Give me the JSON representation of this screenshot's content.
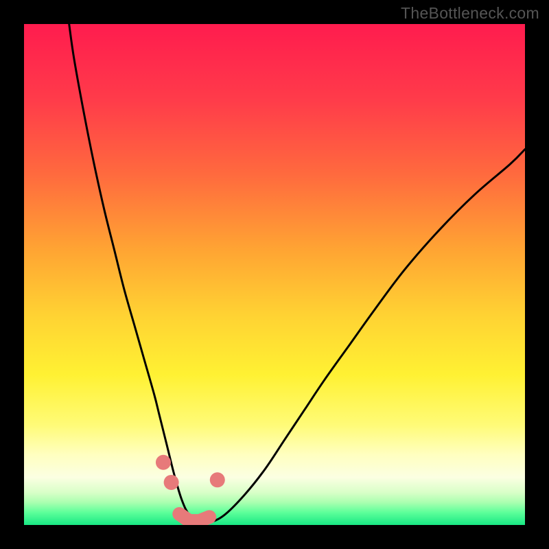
{
  "watermark": "TheBottleneck.com",
  "chart_data": {
    "type": "line",
    "title": "",
    "xlabel": "",
    "ylabel": "",
    "xlim": [
      0,
      100
    ],
    "ylim": [
      0,
      100
    ],
    "grid": false,
    "legend": false,
    "gradient_stops": [
      {
        "offset": 0.0,
        "color": "#ff1c4e"
      },
      {
        "offset": 0.15,
        "color": "#ff3b4a"
      },
      {
        "offset": 0.3,
        "color": "#ff6a3e"
      },
      {
        "offset": 0.45,
        "color": "#ffa433"
      },
      {
        "offset": 0.58,
        "color": "#ffd233"
      },
      {
        "offset": 0.7,
        "color": "#fff133"
      },
      {
        "offset": 0.8,
        "color": "#fffb77"
      },
      {
        "offset": 0.86,
        "color": "#ffffc0"
      },
      {
        "offset": 0.905,
        "color": "#fbffe2"
      },
      {
        "offset": 0.935,
        "color": "#d9ffc8"
      },
      {
        "offset": 0.955,
        "color": "#aaffb0"
      },
      {
        "offset": 0.975,
        "color": "#5dff9a"
      },
      {
        "offset": 1.0,
        "color": "#18e884"
      }
    ],
    "series": [
      {
        "name": "bottleneck-curve",
        "color": "#000000",
        "x": [
          9,
          10,
          12,
          14,
          16,
          18,
          20,
          22,
          24,
          26,
          27,
          28.5,
          30,
          31.5,
          33,
          35,
          37,
          40,
          44,
          48,
          52,
          56,
          60,
          65,
          70,
          76,
          83,
          90,
          97,
          100
        ],
        "y": [
          100,
          93,
          82,
          72,
          63,
          55,
          47,
          40,
          33,
          26,
          22,
          16,
          10,
          5,
          2,
          0.5,
          0.5,
          2,
          6,
          11,
          17,
          23,
          29,
          36,
          43,
          51,
          59,
          66,
          72,
          75
        ]
      },
      {
        "name": "highlight-markers",
        "color": "#e77a7a",
        "style": "dots-and-segment",
        "x": [
          27.8,
          29.4,
          31.0,
          33.0,
          35.0,
          37.0,
          38.6
        ],
        "y": [
          12.5,
          8.5,
          2.2,
          0.8,
          0.8,
          1.6,
          9.0
        ]
      }
    ]
  }
}
